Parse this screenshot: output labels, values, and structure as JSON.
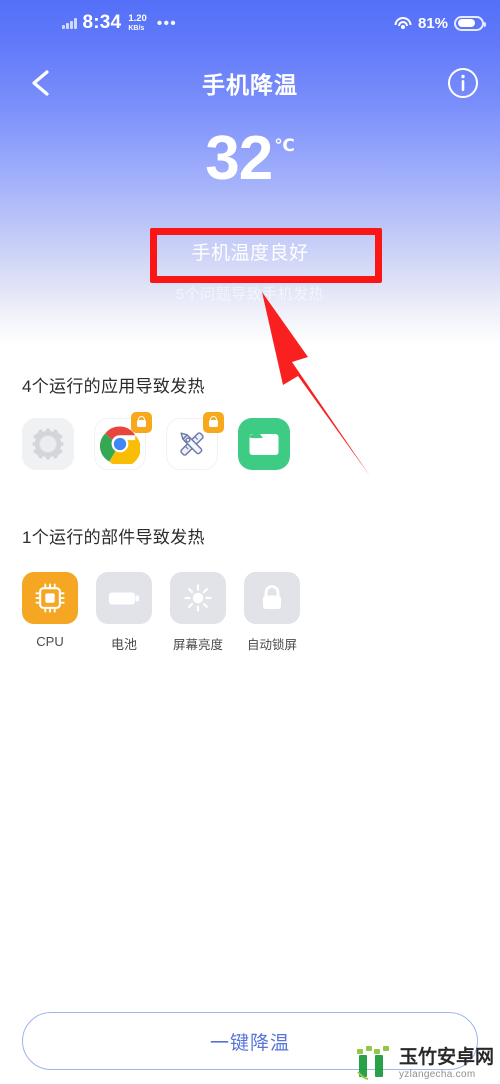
{
  "theme": {
    "gradient_top": "#5470f8",
    "gradient_bottom": "#ffffff",
    "accent_orange": "#f5a623",
    "annotation_red": "#fb1616",
    "button_blue": "#5874d8"
  },
  "status_bar": {
    "time": "8:34",
    "net_speed_value": "1.20",
    "net_speed_unit": "KB/s",
    "overflow_dots": "•••",
    "battery_percent": "81%",
    "signal_icon": "signal-bars-icon",
    "wifi_icon": "wifi-icon",
    "battery_icon": "battery-icon"
  },
  "title_bar": {
    "back_icon": "back-chevron-icon",
    "title": "手机降温",
    "info_icon": "info-circle-icon"
  },
  "hero": {
    "temperature": "32",
    "unit": "℃",
    "status_text": "手机温度良好",
    "sub_text": "5个问题导致手机发热"
  },
  "apps_section": {
    "title": "4个运行的应用导致发热",
    "items": [
      {
        "name": "settings-app",
        "icon": "gear-icon",
        "locked": false
      },
      {
        "name": "chrome-app",
        "icon": "chrome-icon",
        "locked": true
      },
      {
        "name": "tools-app",
        "icon": "crossed-tools-icon",
        "locked": true
      },
      {
        "name": "file-manager-app",
        "icon": "folder-icon",
        "locked": false
      }
    ]
  },
  "components_section": {
    "title": "1个运行的部件导致发热",
    "items": [
      {
        "label": "CPU",
        "icon": "cpu-chip-icon",
        "active": true
      },
      {
        "label": "电池",
        "icon": "battery-icon",
        "active": false
      },
      {
        "label": "屏幕亮度",
        "icon": "brightness-sun-icon",
        "active": false
      },
      {
        "label": "自动锁屏",
        "icon": "lock-icon",
        "active": false
      }
    ]
  },
  "bottom_action": {
    "label": "一键降温"
  },
  "watermark": {
    "site_cn": "玉竹安卓网",
    "site_url": "yzlangecha.com"
  }
}
